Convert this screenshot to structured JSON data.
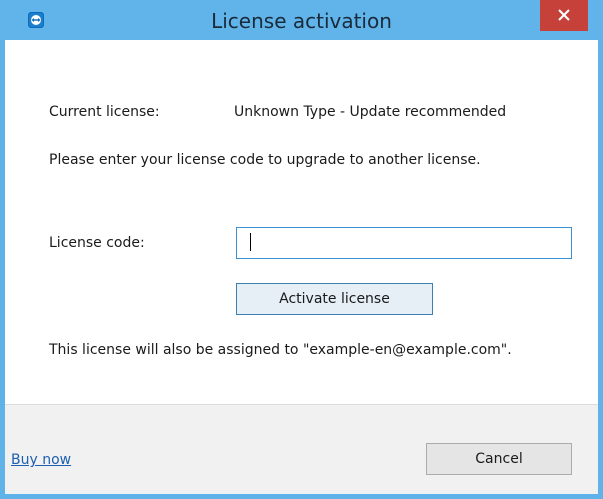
{
  "window": {
    "title": "License activation",
    "titlebar_color": "#61b4e9",
    "close_color": "#c7413b",
    "app_icon": "teamviewer-icon",
    "close_icon": "close-icon"
  },
  "info": {
    "current_license_label": "Current license:",
    "current_license_value": "Unknown Type - Update recommended",
    "instructions": "Please enter your license code to upgrade to another license."
  },
  "form": {
    "license_code_label": "License code:",
    "license_code_value": "",
    "activate_button": "Activate license",
    "assignment_note": "This license will also be assigned to \"example-en@example.com\"."
  },
  "footer": {
    "buy_now_link": "Buy now",
    "cancel_button": "Cancel"
  }
}
